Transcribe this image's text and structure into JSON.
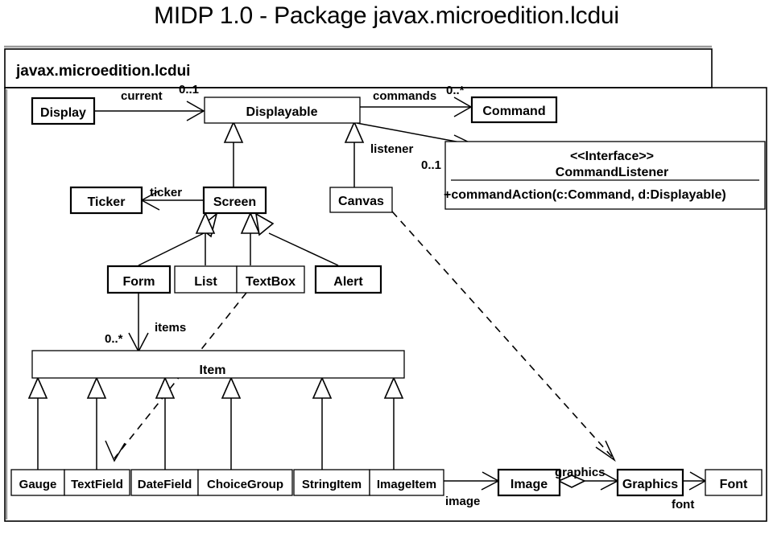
{
  "title": "MIDP 1.0 - Package javax.microedition.lcdui",
  "package": {
    "name": "javax.microedition.lcdui"
  },
  "classes": {
    "display": "Display",
    "displayable": "Displayable",
    "command": "Command",
    "ticker": "Ticker",
    "screen": "Screen",
    "canvas": "Canvas",
    "form": "Form",
    "list": "List",
    "textbox": "TextBox",
    "alert": "Alert",
    "item": "Item",
    "gauge": "Gauge",
    "textfield": "TextField",
    "datefield": "DateField",
    "choicegroup": "ChoiceGroup",
    "stringitem": "StringItem",
    "imageitem": "ImageItem",
    "image": "Image",
    "graphics": "Graphics",
    "font": "Font"
  },
  "interface": {
    "stereotype": "<<Interface>>",
    "name": "CommandListener",
    "operation": "+commandAction(c:Command, d:Displayable)"
  },
  "associations": {
    "current_role": "current",
    "current_mult": "0..1",
    "commands_role": "commands",
    "commands_mult": "0..*",
    "listener_role": "listener",
    "listener_mult": "0..1",
    "ticker_role": "ticker",
    "items_role": "items",
    "items_mult": "0..*",
    "image_role": "image",
    "graphics_role": "graphics",
    "font_role": "font"
  },
  "colors": {
    "stroke": "#000000",
    "fill": "#ffffff",
    "shadow": "#9a9a9a"
  }
}
